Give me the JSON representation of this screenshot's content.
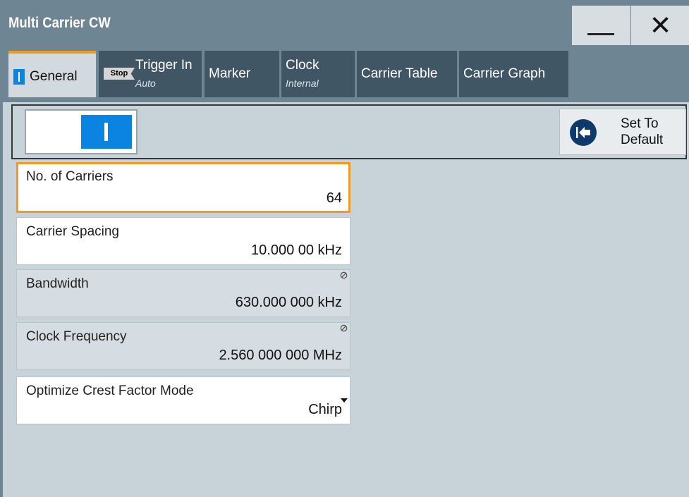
{
  "window": {
    "title": "Multi Carrier CW"
  },
  "tabs": [
    {
      "label": "General",
      "sub": "",
      "badge": ""
    },
    {
      "label": "Trigger In",
      "sub": "Auto",
      "badge": "Stop"
    },
    {
      "label": "Marker",
      "sub": "",
      "badge": ""
    },
    {
      "label": "Clock",
      "sub": "Internal",
      "badge": ""
    },
    {
      "label": "Carrier Table",
      "sub": "",
      "badge": ""
    },
    {
      "label": "Carrier Graph",
      "sub": "",
      "badge": ""
    }
  ],
  "toolbar": {
    "state_on": true,
    "set_default_line1": "Set To",
    "set_default_line2": "Default"
  },
  "fields": [
    {
      "label": "No. of Carriers",
      "value": "64",
      "read_only": false,
      "focused": true
    },
    {
      "label": "Carrier Spacing",
      "value": "10.000 00 kHz",
      "read_only": false,
      "focused": false
    },
    {
      "label": "Bandwidth",
      "value": "630.000 000 kHz",
      "read_only": true,
      "focused": false
    },
    {
      "label": "Clock Frequency",
      "value": "2.560 000 000 MHz",
      "read_only": true,
      "focused": false
    },
    {
      "label": "Optimize Crest Factor Mode",
      "value": "Chirp",
      "read_only": false,
      "focused": false,
      "dropdown": true
    }
  ],
  "colors": {
    "accent": "#f09a22",
    "on_blue": "#0a84e0",
    "titlebar": "#6e8594",
    "tab_inactive": "#415665",
    "panel": "#c8d2d9"
  }
}
